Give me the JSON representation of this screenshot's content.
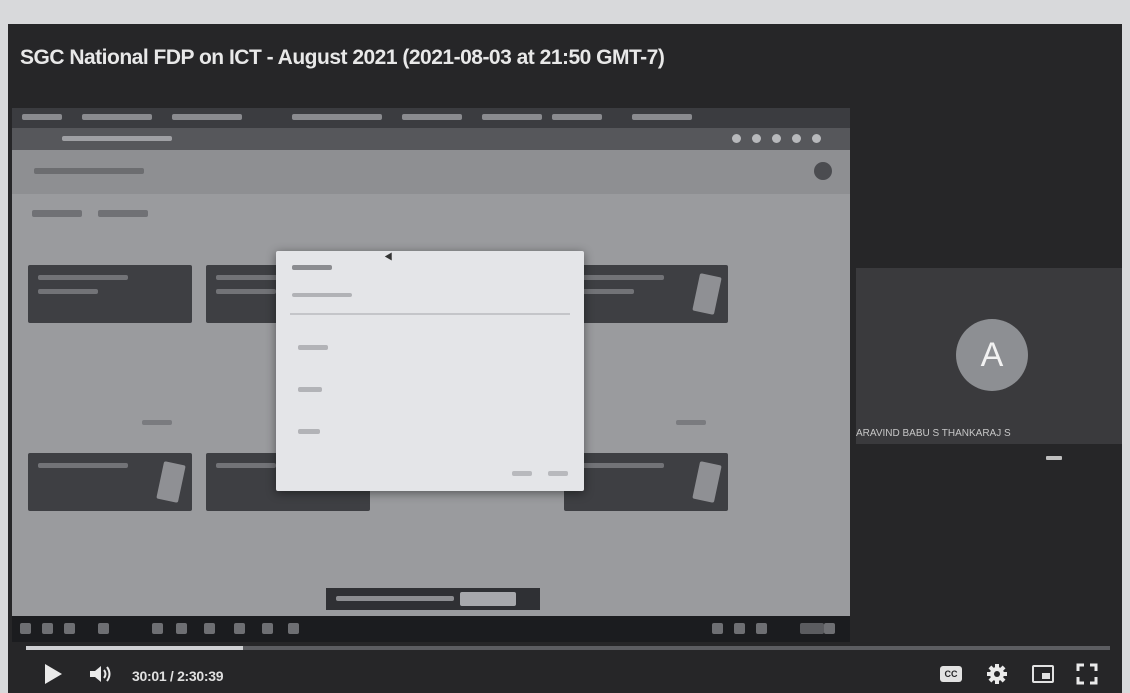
{
  "video": {
    "title": "SGC National FDP on ICT - August 2021 (2021-08-03 at 21:50 GMT-7)",
    "time_display": "30:01 / 2:30:39",
    "progress_fraction": 0.2
  },
  "participant": {
    "avatar_letter": "A",
    "name": "ARAVIND BABU S THANKARAJ S"
  },
  "controls": {
    "play": "play-icon",
    "volume": "volume-icon",
    "captions": "captions-icon",
    "settings": "gear-icon",
    "miniplayer": "miniplayer-icon",
    "fullscreen": "fullscreen-icon"
  },
  "colors": {
    "player_bg": "#262628",
    "progress_fill": "#cfd0d3"
  }
}
